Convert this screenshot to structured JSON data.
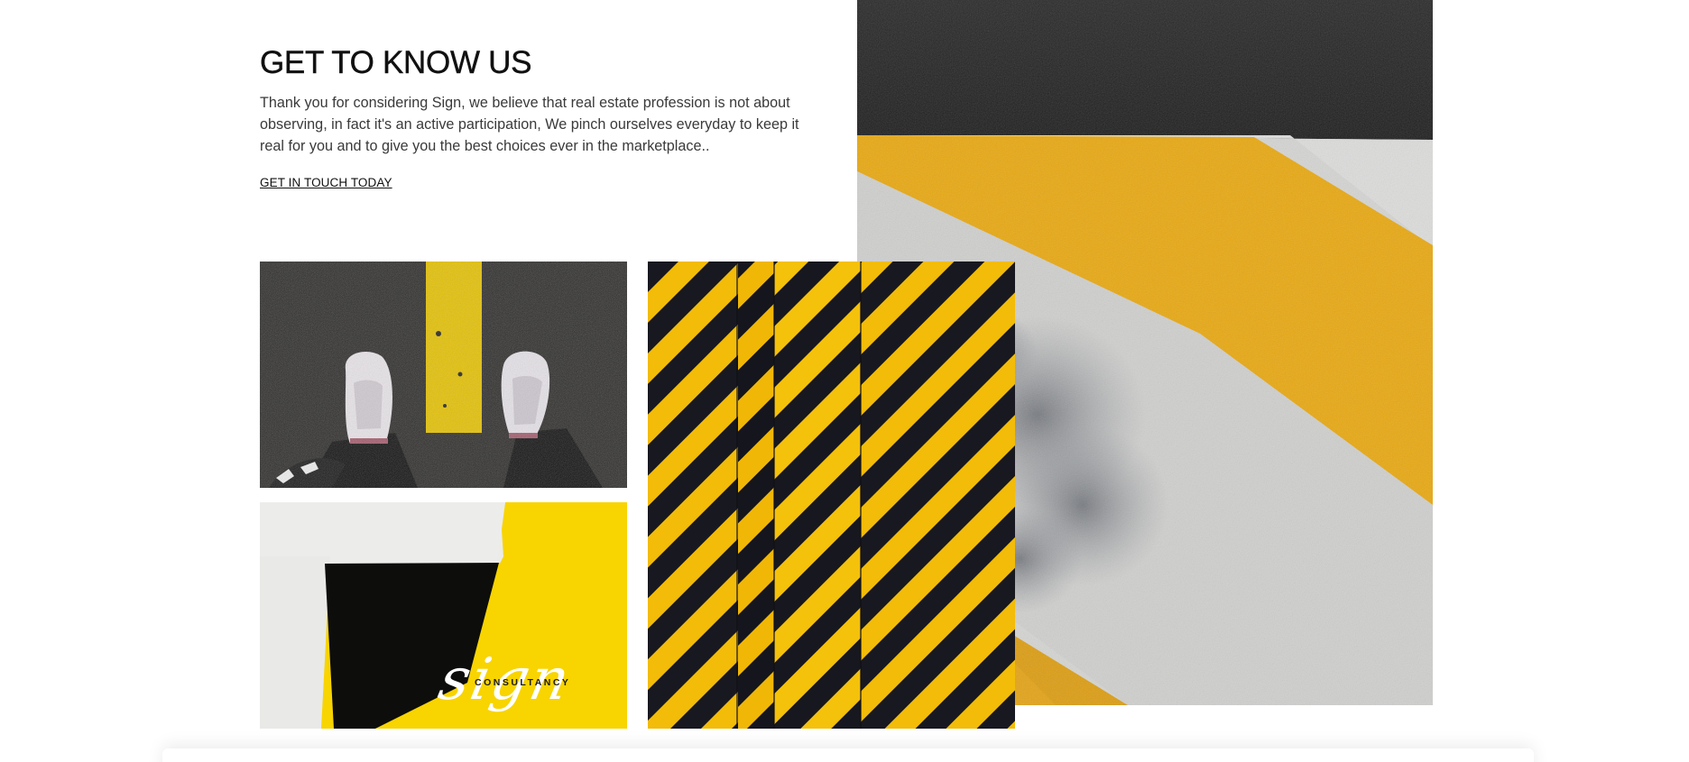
{
  "about": {
    "title": "GET TO KNOW US",
    "body": "Thank you for considering Sign, we believe that real estate profession is not about observing, in fact it's an active participation, We pinch ourselves everyday to keep it real for you and to give you the best choices ever in the marketplace..",
    "cta_label": "GET IN TOUCH TODAY"
  },
  "gallery": {
    "sign_logo_word": "sign",
    "sign_logo_sub": "CONSULTANCY"
  },
  "colors": {
    "accent_yellow": "#f7c400",
    "asphalt": "#2b2b2a",
    "text_dark": "#111111",
    "text_body": "#3a3a3a"
  }
}
